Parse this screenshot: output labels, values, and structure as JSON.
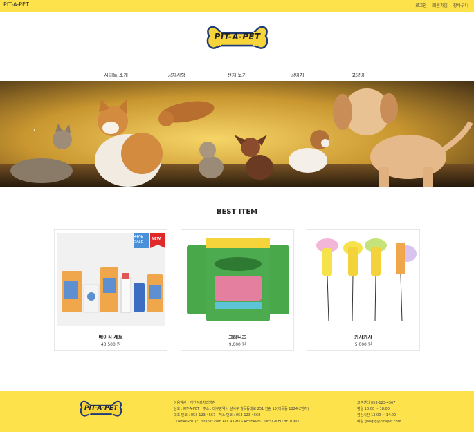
{
  "topbar": {
    "brand": "PIT-A-PET",
    "links": [
      "로그인",
      "회원가입",
      "장바구니"
    ]
  },
  "logo": {
    "text": "PIT-A-PET"
  },
  "nav": {
    "items": [
      "사이트 소개",
      "공지사항",
      "전체 보기",
      "강아지",
      "고양이"
    ]
  },
  "banner": {
    "prev_icon": "chevron-left-icon",
    "next_icon": "chevron-right-icon"
  },
  "best": {
    "title": "BEST ITEM",
    "products": [
      {
        "name": "베이직 세트",
        "price": "43,500 원",
        "badges": [
          "40% SALE",
          "NEW"
        ]
      },
      {
        "name": "그리니즈",
        "price": "9,000 원",
        "badges": []
      },
      {
        "name": "카샤카샤",
        "price": "5,000 원",
        "badges": []
      }
    ],
    "badge_sale_top": "40%",
    "badge_sale_bottom": "SALE",
    "badge_new": "NEW"
  },
  "footer": {
    "logo_text": "PIT-A-PET",
    "info_lines": [
      "이용약관 | 개인정보처리방침",
      "상호 : PIT-A-PET | 주소 : 대구광역시 달서구 월곡동대로 251 한림 15(이곡동 1224-2번지)",
      "대표 번호 : 053-123-4567 | 팩스 번호 : 053-123-4568",
      "COPYRIGHT (c) pitapet.com ALL RIGHTS RESERVED. DESIGNED BY TURU."
    ],
    "cs_lines": [
      "고객센터 053-123-4567",
      "평일 10:00 ~ 18:00",
      "점심시간 13:00 ~ 14:00",
      "메일 gangrg@pitapet.com"
    ]
  },
  "colors": {
    "brand_yellow": "#fde24b",
    "logo_yellow": "#f7d53a"
  }
}
